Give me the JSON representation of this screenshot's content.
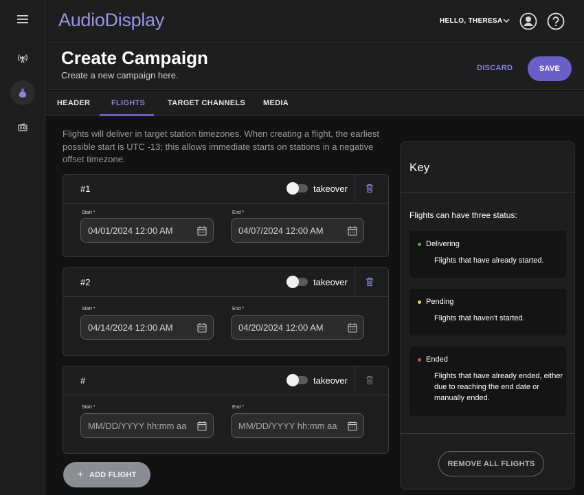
{
  "app": {
    "logo": "AudioDisplay",
    "logo_mark": "."
  },
  "header": {
    "greeting": "HELLO, THERESA"
  },
  "page": {
    "title": "Create Campaign",
    "subtitle": "Create a new campaign here.",
    "discard_label": "DISCARD",
    "save_label": "SAVE"
  },
  "tabs": [
    {
      "label": "HEADER"
    },
    {
      "label": "FLIGHTS"
    },
    {
      "label": "TARGET CHANNELS"
    },
    {
      "label": "MEDIA"
    }
  ],
  "flights_info": "Flights will deliver in target station timezones. When creating a flight, the earliest possible start is UTC -13; this allows immediate starts on stations in a negative offset timezone.",
  "flights": [
    {
      "number": "#1",
      "takeover_label": "takeover",
      "start_label": "Start *",
      "end_label": "End *",
      "start_value": "04/01/2024 12:00 AM",
      "end_value": "04/07/2024 12:00 AM"
    },
    {
      "number": "#2",
      "takeover_label": "takeover",
      "start_label": "Start *",
      "end_label": "End *",
      "start_value": "04/14/2024 12:00 AM",
      "end_value": "04/20/2024 12:00 AM"
    },
    {
      "number": "#",
      "takeover_label": "takeover",
      "start_label": "Start *",
      "end_label": "End *",
      "start_placeholder": "MM/DD/YYYY hh:mm aa",
      "end_placeholder": "MM/DD/YYYY hh:mm aa"
    }
  ],
  "add_flight_label": "ADD FLIGHT",
  "key": {
    "title": "Key",
    "intro": "Flights can have three status:",
    "statuses": [
      {
        "name": "Delivering",
        "description": "Flights that have already started.",
        "color": "#4caf50"
      },
      {
        "name": "Pending",
        "description": "Flights that haven't started.",
        "color": "#e5d84a"
      },
      {
        "name": "Ended",
        "description": "Flights that have already ended, either due to reaching the end date or manually ended.",
        "color": "#e04848"
      }
    ],
    "remove_all_label": "REMOVE ALL FLIGHTS"
  },
  "colors": {
    "accent": "#6a5fc8",
    "accent_text": "#8d83df",
    "background": "#121212",
    "surface": "#1e1e1e"
  },
  "icons": [
    "menu-icon",
    "broadcast-icon",
    "money-bag-icon",
    "radio-icon",
    "chevron-down-icon",
    "account-circle-icon",
    "help-circle-icon",
    "trash-icon",
    "calendar-icon",
    "plus-icon"
  ]
}
